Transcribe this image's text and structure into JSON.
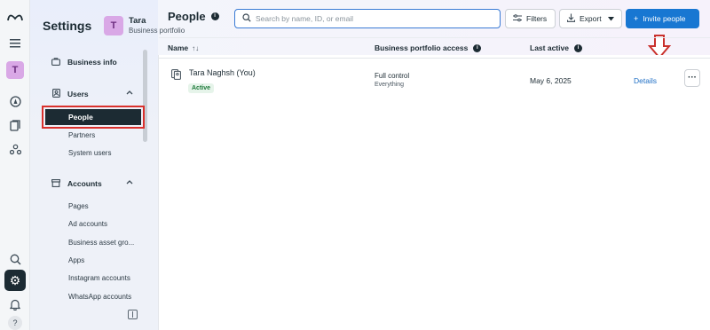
{
  "rail": {
    "items": [
      {
        "icon": "meta-logo-icon"
      },
      {
        "icon": "menu-icon"
      },
      {
        "icon": "avatar",
        "label": "T"
      },
      {
        "icon": "compass-icon"
      },
      {
        "icon": "pages-icon"
      },
      {
        "icon": "people-network-icon"
      },
      {
        "icon": "search-icon"
      },
      {
        "icon": "gear-icon"
      },
      {
        "icon": "bell-icon"
      },
      {
        "icon": "help-icon"
      }
    ],
    "avatar_letter": "T",
    "help_glyph": "?"
  },
  "header": {
    "settings_title": "Settings",
    "portfolio_avatar": "T",
    "portfolio_name": "Tara",
    "portfolio_sub": "Business portfolio"
  },
  "sidebar": {
    "business_info": "Business info",
    "users_section": "Users",
    "users_items": [
      "People",
      "Partners",
      "System users"
    ],
    "accounts_section": "Accounts",
    "accounts_items": [
      "Pages",
      "Ad accounts",
      "Business asset gro...",
      "Apps",
      "Instagram accounts",
      "WhatsApp accounts"
    ],
    "selected": "People"
  },
  "main": {
    "title": "People",
    "search_placeholder": "Search by name, ID, or email",
    "filters_label": "Filters",
    "export_label": "Export",
    "invite_label": "Invite people",
    "columns": {
      "name": "Name",
      "sort_glyph": "↑↓",
      "access": "Business portfolio access",
      "last_active": "Last active"
    },
    "rows": [
      {
        "name": "Tara Naghsh (You)",
        "status": "Active",
        "access": "Full control",
        "access_detail": "Everything",
        "last_active": "May 6, 2025",
        "action": "Details",
        "more": "···"
      }
    ]
  },
  "colors": {
    "accent": "#1877d2",
    "highlight_box": "#d9302c",
    "selected_bg": "#1c2b33",
    "active_badge": "#1e7a3a"
  }
}
